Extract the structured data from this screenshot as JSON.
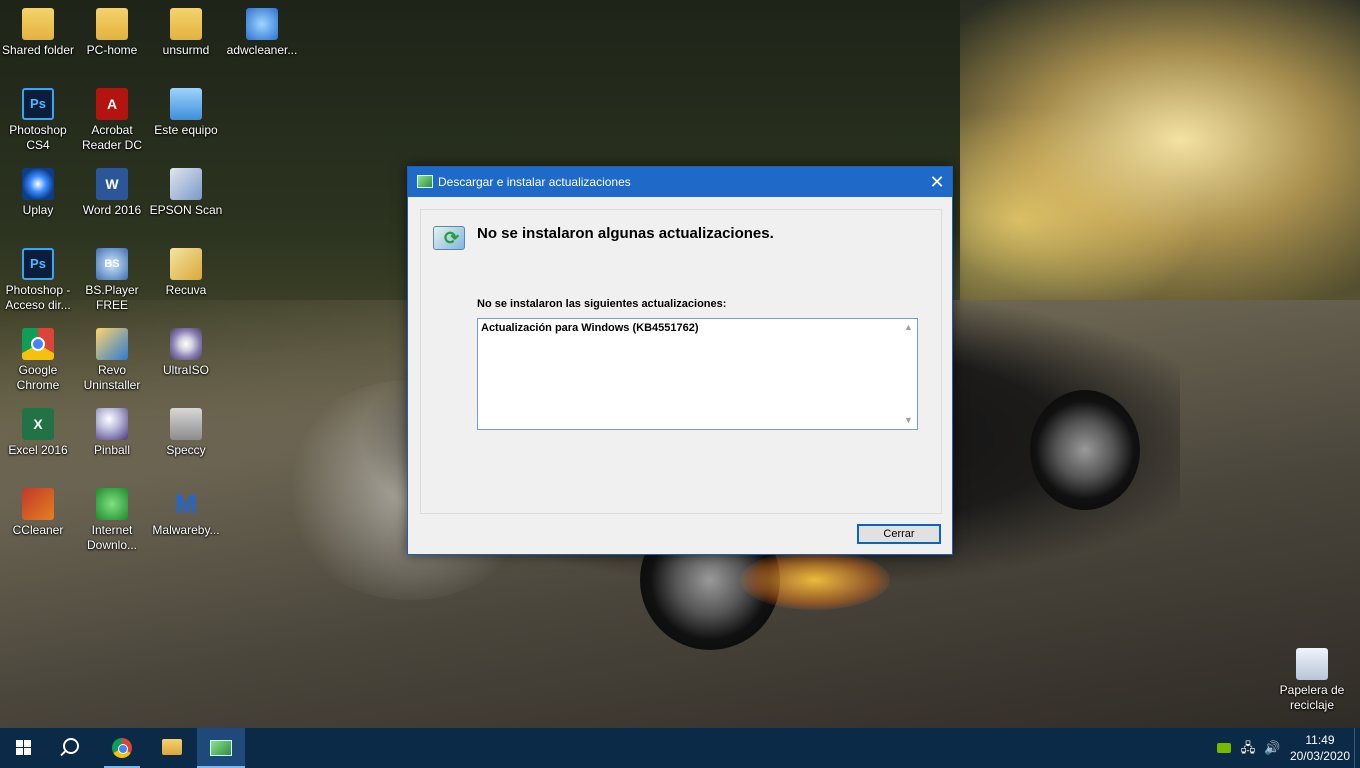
{
  "desktop": {
    "icons": [
      {
        "label": "Shared folder",
        "icon": "folder-icon"
      },
      {
        "label": "PC-home",
        "icon": "user-folder-icon"
      },
      {
        "label": "unsurmd",
        "icon": "folder-icon"
      },
      {
        "label": "adwcleaner...",
        "icon": "adwcleaner-icon"
      },
      {
        "label": "Photoshop\nCS4",
        "icon": "photoshop-icon",
        "glyph": "Ps"
      },
      {
        "label": "Acrobat\nReader DC",
        "icon": "acrobat-icon",
        "glyph": "A"
      },
      {
        "label": "Este equipo",
        "icon": "computer-icon"
      },
      {
        "label": "Uplay",
        "icon": "uplay-icon"
      },
      {
        "label": "Word 2016",
        "icon": "word-icon",
        "glyph": "W"
      },
      {
        "label": "EPSON Scan",
        "icon": "scanner-icon"
      },
      {
        "label": "Photoshop -\nAcceso dir...",
        "icon": "photoshop-icon",
        "glyph": "Ps"
      },
      {
        "label": "BS.Player\nFREE",
        "icon": "bsplayer-icon",
        "glyph": "BS"
      },
      {
        "label": "Recuva",
        "icon": "recuva-icon"
      },
      {
        "label": "Google\nChrome",
        "icon": "chrome-icon"
      },
      {
        "label": "Revo\nUninstaller",
        "icon": "revo-icon"
      },
      {
        "label": "UltraISO",
        "icon": "ultraiso-icon"
      },
      {
        "label": "Excel 2016",
        "icon": "excel-icon",
        "glyph": "X"
      },
      {
        "label": "Pinball",
        "icon": "pinball-icon"
      },
      {
        "label": "Speccy",
        "icon": "speccy-icon"
      },
      {
        "label": "CCleaner",
        "icon": "ccleaner-icon"
      },
      {
        "label": "Internet\nDownlo...",
        "icon": "idm-icon"
      },
      {
        "label": "Malwareby...",
        "icon": "malwarebytes-icon",
        "glyph": "M"
      }
    ],
    "recycle_bin": {
      "label": "Papelera de\nreciclaje"
    }
  },
  "dialog": {
    "title": "Descargar e instalar actualizaciones",
    "close_glyph": "✕",
    "heading": "No se instalaron algunas actualizaciones.",
    "list_label": "No se instalaron las siguientes actualizaciones:",
    "updates": [
      "Actualización para Windows (KB4551762)"
    ],
    "scroll_up": "▲",
    "scroll_down": "▼",
    "close_button": "Cerrar"
  },
  "taskbar": {
    "apps": [
      {
        "name": "start-button",
        "icon": "windows-logo-icon"
      },
      {
        "name": "search-button",
        "icon": "search-icon"
      },
      {
        "name": "taskbar-chrome",
        "icon": "chrome-icon",
        "running": true
      },
      {
        "name": "taskbar-file-explorer",
        "icon": "file-explorer-icon"
      },
      {
        "name": "taskbar-windows-update",
        "icon": "windows-update-icon",
        "active": true
      }
    ],
    "tray": {
      "nvidia": "nvidia-icon",
      "network_glyph": "🖧",
      "volume_glyph": "🔊"
    },
    "clock": {
      "time": "11:49",
      "date": "20/03/2020"
    }
  }
}
